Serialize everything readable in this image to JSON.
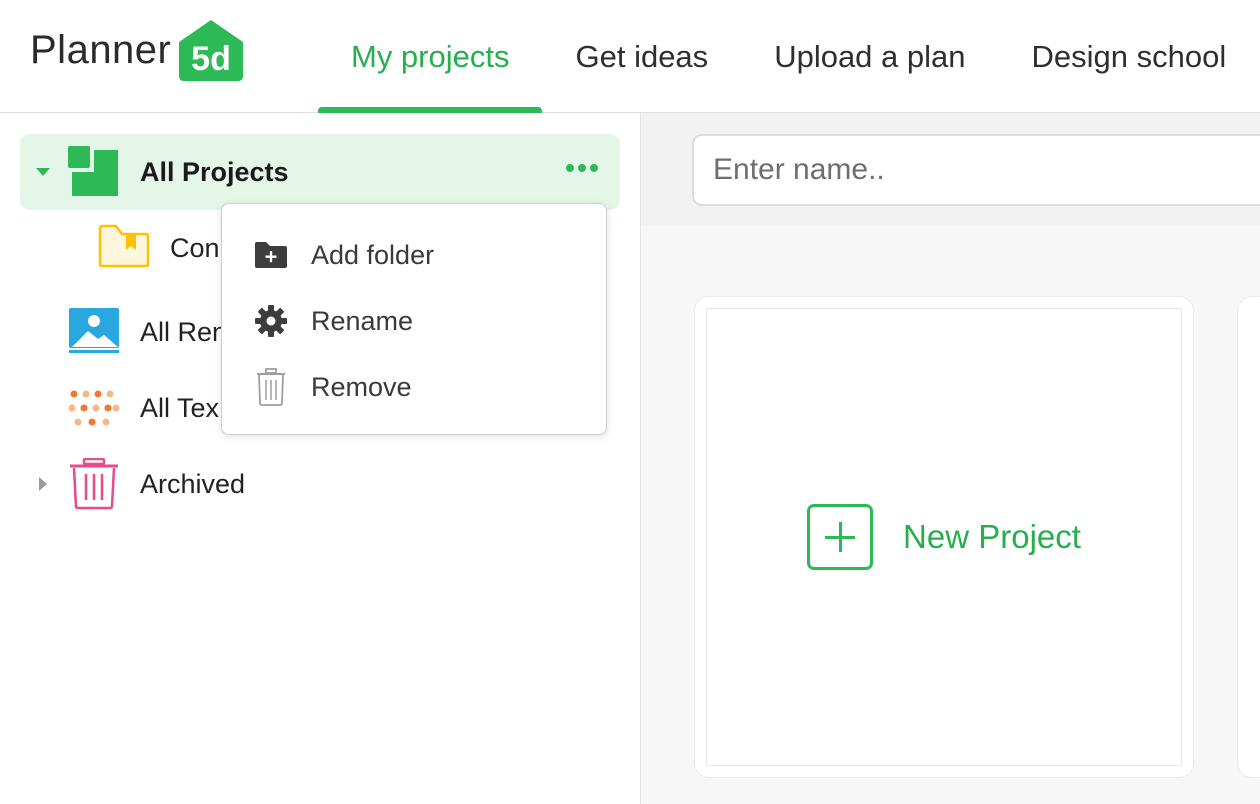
{
  "header": {
    "logo_text": "Planner",
    "logo_badge": "5d",
    "nav": [
      {
        "label": "My projects",
        "active": true
      },
      {
        "label": "Get ideas",
        "active": false
      },
      {
        "label": "Upload a plan",
        "active": false
      },
      {
        "label": "Design school",
        "active": false
      }
    ]
  },
  "sidebar": {
    "items": [
      {
        "label": "All Projects",
        "icon": "all-projects-icon",
        "selected": true,
        "expanded": true
      },
      {
        "label": "Con",
        "icon": "folder-bookmark-icon",
        "child": true
      },
      {
        "label": "All Ren",
        "icon": "image-icon"
      },
      {
        "label": "All Tex",
        "icon": "textures-dots-icon"
      },
      {
        "label": "Archived",
        "icon": "trash-icon",
        "expandable": true
      }
    ]
  },
  "context_menu": {
    "items": [
      {
        "label": "Add folder",
        "icon": "folder-add-icon"
      },
      {
        "label": "Rename",
        "icon": "gear-icon"
      },
      {
        "label": "Remove",
        "icon": "trash-icon"
      }
    ]
  },
  "main": {
    "search": {
      "placeholder": "Enter name..",
      "value": ""
    },
    "new_project_label": "New Project"
  },
  "colors": {
    "accent": "#2dba56",
    "selected_bg": "#e3f6e8",
    "folder": "#ffc107",
    "image": "#29a8e0",
    "textures": "#f07a2d",
    "archive": "#e84a8a"
  }
}
